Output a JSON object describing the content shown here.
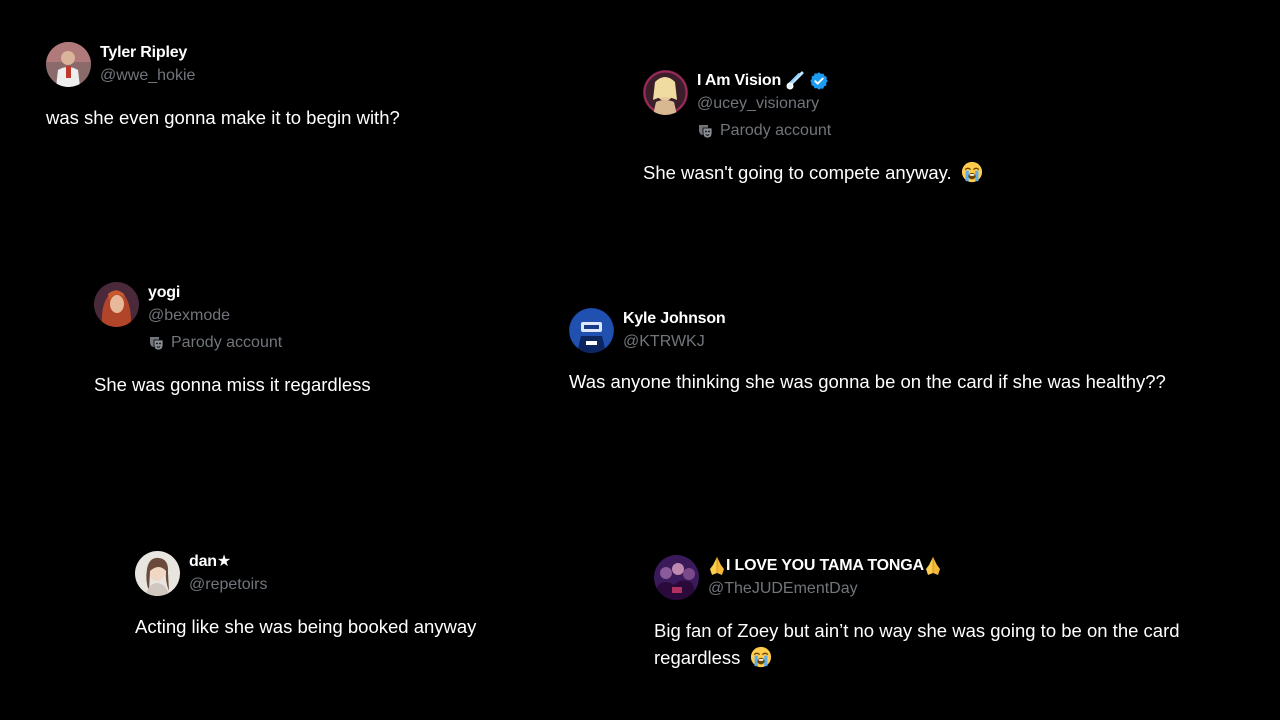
{
  "tweets": [
    {
      "display_name": "Tyler Ripley",
      "handle": "@wwe_hokie",
      "text": "was she even gonna make it to begin with?"
    },
    {
      "display_name": "I Am Vision",
      "handle": "@ucey_visionary",
      "badge": "Parody account",
      "text": "She wasn't going to compete anyway.",
      "icons": [
        "comet-icon",
        "verified-badge-icon",
        "loudly-crying-face-emoji"
      ]
    },
    {
      "display_name": "yogi",
      "handle": "@bexmode",
      "badge": "Parody account",
      "text": "She was gonna miss it regardless"
    },
    {
      "display_name": "Kyle Johnson",
      "handle": "@KTRWKJ",
      "text": "Was anyone thinking she was gonna be on the card if she was healthy??"
    },
    {
      "display_name": "dan★",
      "handle": "@repetoirs",
      "text": "Acting like she was being booked anyway"
    },
    {
      "display_name": "I LOVE YOU TAMA TONGA",
      "handle": "@TheJUDEmentDay",
      "text_line1": "Big fan of Zoey but ain’t no way she was going to be on the card",
      "text_line2": "regardless",
      "icons": [
        "praying-hands-emoji",
        "loudly-crying-face-emoji"
      ]
    }
  ],
  "colors": {
    "background": "#000000",
    "text": "#ffffff",
    "secondary": "#71767b",
    "verified": "#1d9bf0"
  }
}
